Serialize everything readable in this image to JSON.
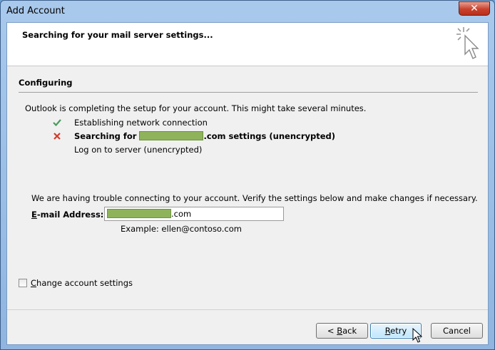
{
  "window": {
    "title": "Add Account",
    "close_label": "✕"
  },
  "header": {
    "title": "Searching for your mail server settings..."
  },
  "section": {
    "title": "Configuring",
    "intro": "Outlook is completing the setup for your account. This might take several minutes."
  },
  "steps": [
    {
      "status": "done",
      "label": "Establishing network connection"
    },
    {
      "status": "failed",
      "label_prefix": "Searching for ",
      "label_suffix": ".com settings (unencrypted)"
    },
    {
      "status": "pending",
      "label": "Log on to server (unencrypted)"
    }
  ],
  "trouble": {
    "message": "We are having trouble connecting to your account. Verify the settings below and make changes if necessary.",
    "email_label_key": "E",
    "email_label_rest": "-mail Address:",
    "email_value_suffix": ".com",
    "example": "Example: ellen@contoso.com"
  },
  "options": {
    "change_settings_key": "C",
    "change_settings_rest": "hange account settings",
    "checked": false
  },
  "buttons": {
    "back_prefix": "< ",
    "back_key": "B",
    "back_rest": "ack",
    "retry_key": "R",
    "retry_rest": "etry",
    "cancel_label": "Cancel"
  },
  "colors": {
    "done": "#4a9a5e",
    "failed": "#d23a2c",
    "redaction": "#8fb35a"
  }
}
